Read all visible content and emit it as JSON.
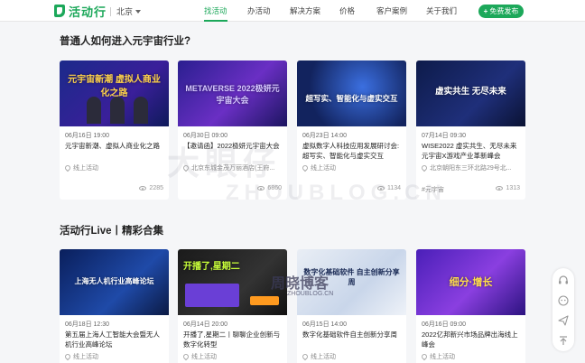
{
  "header": {
    "logo_text": "活动行",
    "city": "北京",
    "nav": [
      {
        "label": "找活动",
        "active": true
      },
      {
        "label": "办活动",
        "active": false
      },
      {
        "label": "解决方案",
        "active": false
      },
      {
        "label": "价格",
        "active": false
      },
      {
        "label": "客户案例",
        "active": false
      },
      {
        "label": "关于我们",
        "active": false
      }
    ],
    "publish_label": "免费发布",
    "accent_color": "#1ca85a"
  },
  "sections": [
    {
      "title": "普通人如何进入元宇宙行业?",
      "cards": [
        {
          "cover_text": "元宇宙新潮 虚拟人商业化之路",
          "date": "06月16日",
          "time": "19:00",
          "title": "元宇宙新潮、虚拟人商业化之路",
          "location": "线上活动",
          "views": "2285",
          "tag": ""
        },
        {
          "cover_text": "METAVERSE 2022极妍元宇宙大会",
          "date": "06月30日",
          "time": "09:00",
          "title": "【邀请函】2022极妍元宇宙大会",
          "location": "北京东城金茂万丽酒店(王府...",
          "views": "6860",
          "tag": ""
        },
        {
          "cover_text": "超写实、智能化与虚实交互",
          "date": "06月23日",
          "time": "14:00",
          "title": "虚拟数字人科技应用发展研讨会:超写实、智能化与虚实交互",
          "location": "线上活动",
          "views": "1134",
          "tag": ""
        },
        {
          "cover_text": "虚实共生 无尽未来",
          "date": "07月14日",
          "time": "09:30",
          "title": "WISE2022 虚实共生、无尽未来 元宇宙X游戏产业革新峰会",
          "location": "北京朝阳东三环北路29号北...",
          "views": "1313",
          "tag": "#元宇宙"
        }
      ]
    },
    {
      "title": "活动行Live丨精彩合集",
      "cards": [
        {
          "cover_text": "上海无人机行业高峰论坛",
          "date": "06月18日",
          "time": "12:30",
          "title": "第五届上海人工智能大会暨无人机行业高峰论坛",
          "location": "线上活动",
          "views": "",
          "tag": ""
        },
        {
          "cover_text": "开播了,星期二",
          "date": "06月14日",
          "time": "20:00",
          "title": "开播了,星期二丨聊聊企业创新与数字化转型",
          "location": "线上活动",
          "views": "",
          "tag": ""
        },
        {
          "cover_text": "数字化基础软件 自主创新分享周",
          "date": "06月15日",
          "time": "14:00",
          "title": "数字化基础软件自主创新分享周",
          "location": "线上活动",
          "views": "",
          "tag": ""
        },
        {
          "cover_text": "细分·增长",
          "date": "06月16日",
          "time": "09:00",
          "title": "2022亿邦新兴市场品牌出海线上峰会",
          "location": "线上活动",
          "views": "",
          "tag": ""
        }
      ]
    }
  ],
  "watermark": {
    "line1": "大眼仔",
    "line2": "ZHOUBLOG.CN",
    "line3": "周晓博客",
    "line4": "ZHOUBLOG.CN"
  }
}
